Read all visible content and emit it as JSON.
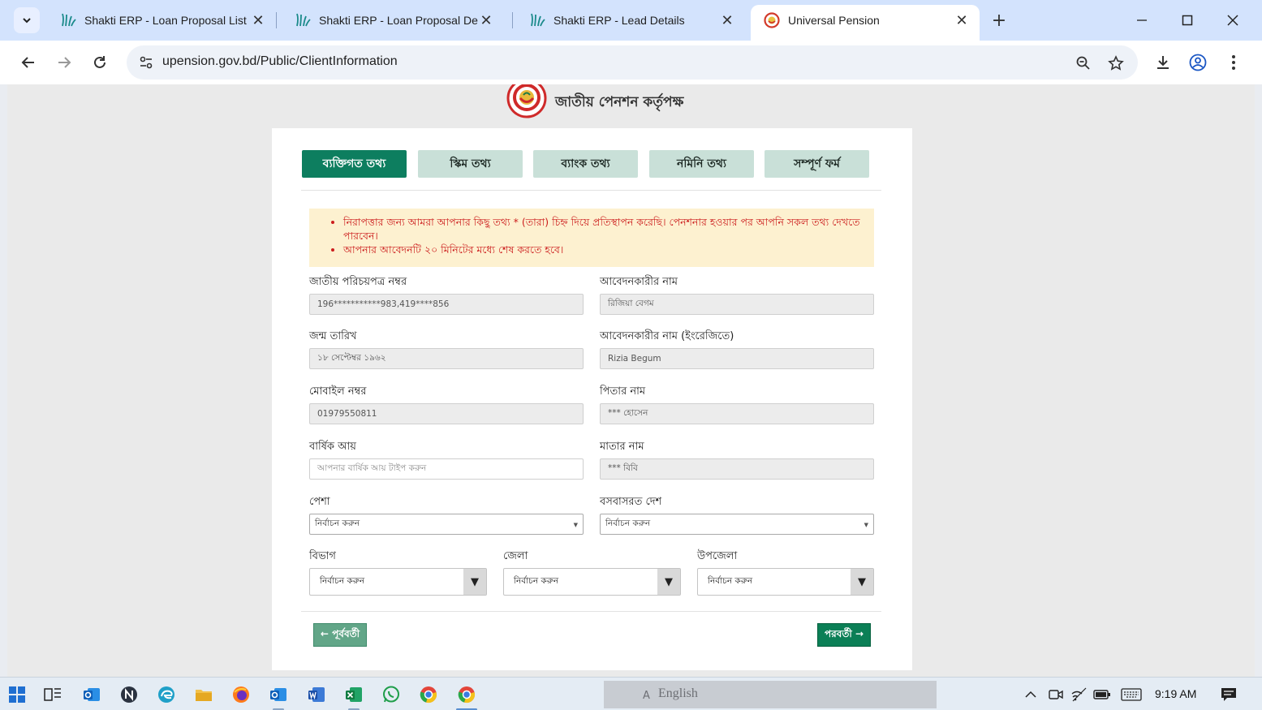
{
  "browser": {
    "tabs": [
      {
        "title": "Shakti ERP - Loan Proposal List"
      },
      {
        "title": "Shakti ERP - Loan Proposal Details"
      },
      {
        "title": "Shakti ERP - Lead Details"
      },
      {
        "title": "Universal Pension"
      }
    ],
    "active_tab": 3,
    "url": "upension.gov.bd/Public/ClientInformation"
  },
  "header": {
    "org_name": "জাতীয় পেনশন কর্তৃপক্ষ"
  },
  "steps": [
    {
      "label": "ব্যক্তিগত তথ্য",
      "active": true
    },
    {
      "label": "স্কিম তথ্য",
      "active": false
    },
    {
      "label": "ব্যাংক তথ্য",
      "active": false
    },
    {
      "label": "নমিনি তথ্য",
      "active": false
    },
    {
      "label": "সম্পূর্ণ ফর্ম",
      "active": false
    }
  ],
  "notice": {
    "items": [
      "নিরাপত্তার জন্য আমরা আপনার কিছু তথ্য * (তারা) চিহ্ন দিয়ে প্রতিস্থাপন করেছি। পেনশনার হওয়ার পর আপনি সকল তথ্য দেখতে পারবেন।",
      "আপনার আবেদনটি ২০ মিনিটের মধ্যে শেষ করতে হবে।"
    ]
  },
  "form": {
    "nid": {
      "label": "জাতীয় পরিচয়পত্র নম্বর",
      "value": "196***********983,419****856"
    },
    "applicant_name": {
      "label": "আবেদনকারীর নাম",
      "value": "রিজিয়া বেগম"
    },
    "dob": {
      "label": "জন্ম তারিখ",
      "value": "১৮ সেপ্টেম্বর ১৯৬২"
    },
    "applicant_name_en": {
      "label": "আবেদনকারীর নাম (ইংরেজিতে)",
      "value": "Rizia Begum"
    },
    "mobile": {
      "label": "মোবাইল নম্বর",
      "value": "01979550811"
    },
    "father_name": {
      "label": "পিতার নাম",
      "value": "*** হোসেন"
    },
    "annual_income": {
      "label": "বার্ষিক আয়",
      "placeholder": "আপনার বার্ষিক আয় টাইপ করুন"
    },
    "mother_name": {
      "label": "মাতার নাম",
      "value": "*** বিবি"
    },
    "occupation": {
      "label": "পেশা",
      "selected": "নির্বাচন করুন"
    },
    "country": {
      "label": "বসবাসরত দেশ",
      "selected": "নির্বাচন করুন"
    },
    "division": {
      "label": "বিভাগ",
      "selected": "নির্বাচন করুন"
    },
    "district": {
      "label": "জেলা",
      "selected": "নির্বাচন করুন"
    },
    "upazila": {
      "label": "উপজেলা",
      "selected": "নির্বাচন করুন"
    }
  },
  "buttons": {
    "prev": "← পূর্ববর্তী",
    "next": "পরবর্তী →"
  },
  "taskbar": {
    "language": "English",
    "time": "9:19 AM"
  },
  "colors": {
    "brand_green": "#0d7e5f",
    "step_inactive": "#c9e0d8",
    "notice_bg": "#fdf1d0",
    "notice_text": "#cc1d1d"
  }
}
